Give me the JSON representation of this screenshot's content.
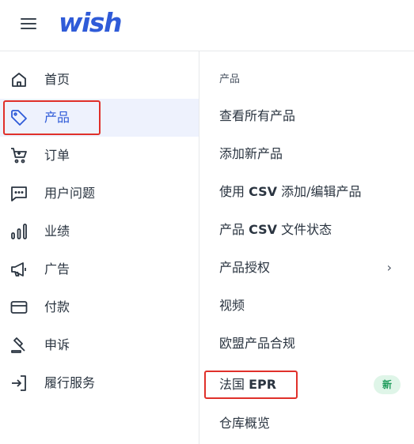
{
  "header": {
    "logo_text": "wish"
  },
  "sidebar": {
    "items": [
      {
        "label": "首页",
        "icon": "home-icon"
      },
      {
        "label": "产品",
        "icon": "tag-icon",
        "active": true
      },
      {
        "label": "订单",
        "icon": "cart-icon"
      },
      {
        "label": "用户问题",
        "icon": "chat-icon"
      },
      {
        "label": "业绩",
        "icon": "bar-chart-icon"
      },
      {
        "label": "广告",
        "icon": "megaphone-icon"
      },
      {
        "label": "付款",
        "icon": "credit-card-icon"
      },
      {
        "label": "申诉",
        "icon": "gavel-icon"
      },
      {
        "label": "履行服务",
        "icon": "login-arrow-icon"
      }
    ]
  },
  "submenu": {
    "heading": "产品",
    "items": [
      {
        "label": "查看所有产品"
      },
      {
        "label": "添加新产品"
      },
      {
        "label_prefix": "使用 ",
        "label_bold": "CSV",
        "label_suffix": " 添加/编辑产品"
      },
      {
        "label_prefix": "产品 ",
        "label_bold": "CSV",
        "label_suffix": " 文件状态"
      },
      {
        "label": "产品授权",
        "chevron": "›"
      },
      {
        "label": "视频"
      },
      {
        "label": "欧盟产品合规"
      },
      {
        "label_prefix": "法国 ",
        "label_bold": "EPR",
        "label_suffix": "",
        "badge": "新"
      },
      {
        "label": "仓库概览"
      }
    ]
  },
  "colors": {
    "brand": "#2f5bd8",
    "active_bg": "#eef2fd",
    "highlight": "#e0302a",
    "badge_bg": "#dff5e8",
    "badge_text": "#1e9b5b"
  }
}
